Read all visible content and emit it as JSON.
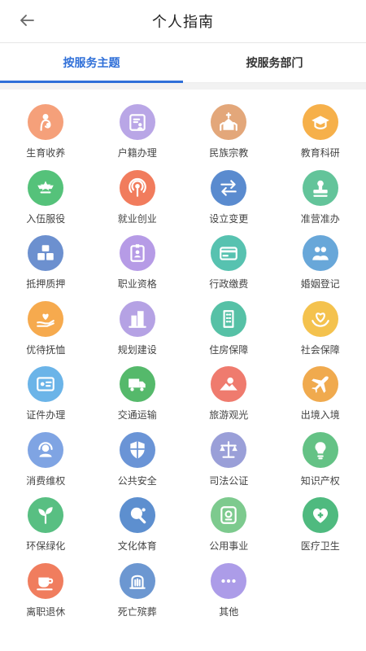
{
  "header": {
    "title": "个人指南"
  },
  "tabs": [
    {
      "label": "按服务主题",
      "active": true
    },
    {
      "label": "按服务部门",
      "active": false
    }
  ],
  "services": [
    {
      "label": "生育收养",
      "icon": "mother-child-icon",
      "color": "#f5a07a"
    },
    {
      "label": "户籍办理",
      "icon": "id-card-icon",
      "color": "#b9a6e6"
    },
    {
      "label": "民族宗教",
      "icon": "church-icon",
      "color": "#e3a77a"
    },
    {
      "label": "教育科研",
      "icon": "graduation-cap-icon",
      "color": "#f6b04a"
    },
    {
      "label": "入伍服役",
      "icon": "army-badge-icon",
      "color": "#55c27a"
    },
    {
      "label": "就业创业",
      "icon": "podcast-icon",
      "color": "#f17c5d"
    },
    {
      "label": "设立变更",
      "icon": "swap-arrows-icon",
      "color": "#5a8bcf"
    },
    {
      "label": "准营准办",
      "icon": "stamp-icon",
      "color": "#63c49a"
    },
    {
      "label": "抵押质押",
      "icon": "boxes-icon",
      "color": "#6c90cf"
    },
    {
      "label": "职业资格",
      "icon": "badge-card-icon",
      "color": "#b69be6"
    },
    {
      "label": "行政缴费",
      "icon": "credit-card-icon",
      "color": "#57c2b0"
    },
    {
      "label": "婚姻登记",
      "icon": "couple-icon",
      "color": "#68a7d9"
    },
    {
      "label": "优待抚恤",
      "icon": "hand-heart-icon",
      "color": "#f6aa4e"
    },
    {
      "label": "规划建设",
      "icon": "buildings-icon",
      "color": "#b5a2e4"
    },
    {
      "label": "住房保障",
      "icon": "building-icon",
      "color": "#56c1a6"
    },
    {
      "label": "社会保障",
      "icon": "heart-hands-icon",
      "color": "#f4c24e"
    },
    {
      "label": "证件办理",
      "icon": "certificate-icon",
      "color": "#6bb4e8"
    },
    {
      "label": "交通运输",
      "icon": "truck-icon",
      "color": "#55b96b"
    },
    {
      "label": "旅游观光",
      "icon": "mountain-sun-icon",
      "color": "#ef7b6e"
    },
    {
      "label": "出境入境",
      "icon": "airplane-icon",
      "color": "#f0aa4e"
    },
    {
      "label": "消费维权",
      "icon": "customer-service-icon",
      "color": "#7fa4e3"
    },
    {
      "label": "公共安全",
      "icon": "shield-icon",
      "color": "#6a94d6"
    },
    {
      "label": "司法公证",
      "icon": "scales-icon",
      "color": "#9a9fd8"
    },
    {
      "label": "知识产权",
      "icon": "lightbulb-icon",
      "color": "#64c285"
    },
    {
      "label": "环保绿化",
      "icon": "sprout-icon",
      "color": "#58bf82"
    },
    {
      "label": "文化体育",
      "icon": "ping-pong-icon",
      "color": "#5d8fcf"
    },
    {
      "label": "公用事业",
      "icon": "public-utility-icon",
      "color": "#7dca8e"
    },
    {
      "label": "医疗卫生",
      "icon": "medical-heart-icon",
      "color": "#4fba7f"
    },
    {
      "label": "离职退休",
      "icon": "coffee-cup-icon",
      "color": "#f07d5e"
    },
    {
      "label": "死亡殡葬",
      "icon": "tombstone-icon",
      "color": "#6c97d1"
    },
    {
      "label": "其他",
      "icon": "more-dots-icon",
      "color": "#ac9ce8"
    }
  ]
}
